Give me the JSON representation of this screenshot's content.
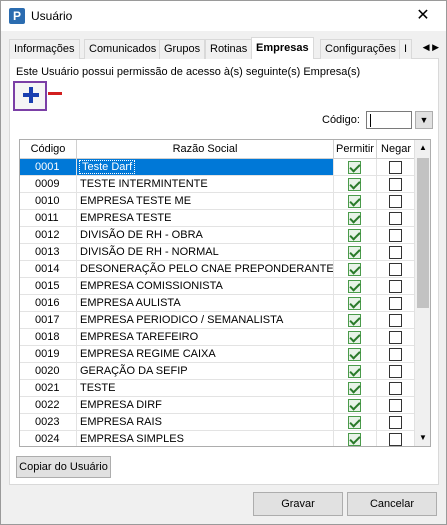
{
  "window": {
    "title": "Usuário",
    "icon_letter": "P",
    "close_glyph": "✕"
  },
  "tabs": [
    {
      "label": "Informações",
      "active": false
    },
    {
      "label": "Comunicados",
      "active": false
    },
    {
      "label": "Grupos",
      "active": false
    },
    {
      "label": "Rotinas",
      "active": false
    },
    {
      "label": "Empresas",
      "active": true
    },
    {
      "label": "Configurações",
      "active": false
    },
    {
      "label": "I",
      "active": false
    }
  ],
  "tab_scroll": {
    "left": "◀",
    "right": "▶"
  },
  "panel": {
    "info_text": "Este Usuário possui permissão de acesso à(s) seguinte(s) Empresa(s)",
    "codigo_label": "Código:",
    "codigo_value": "",
    "dropdown_glyph": "▼"
  },
  "grid": {
    "columns": [
      "Código",
      "Razão Social",
      "Permitir",
      "Negar"
    ],
    "rows": [
      {
        "codigo": "0001",
        "razao": "Teste Darf",
        "permitir": true,
        "negar": false,
        "selected": true
      },
      {
        "codigo": "0009",
        "razao": "TESTE INTERMINTENTE",
        "permitir": true,
        "negar": false
      },
      {
        "codigo": "0010",
        "razao": "EMPRESA TESTE ME",
        "permitir": true,
        "negar": false
      },
      {
        "codigo": "0011",
        "razao": "EMPRESA TESTE",
        "permitir": true,
        "negar": false
      },
      {
        "codigo": "0012",
        "razao": "DIVISÃO DE RH - OBRA",
        "permitir": true,
        "negar": false
      },
      {
        "codigo": "0013",
        "razao": "DIVISÃO DE RH - NORMAL",
        "permitir": true,
        "negar": false
      },
      {
        "codigo": "0014",
        "razao": "DESONERAÇÃO PELO CNAE PREPONDERANTE",
        "permitir": true,
        "negar": false
      },
      {
        "codigo": "0015",
        "razao": "EMPRESA COMISSIONISTA",
        "permitir": true,
        "negar": false
      },
      {
        "codigo": "0016",
        "razao": "EMPRESA AULISTA",
        "permitir": true,
        "negar": false
      },
      {
        "codigo": "0017",
        "razao": "EMPRESA PERIODICO / SEMANALISTA",
        "permitir": true,
        "negar": false
      },
      {
        "codigo": "0018",
        "razao": "EMPRESA TAREFEIRO",
        "permitir": true,
        "negar": false
      },
      {
        "codigo": "0019",
        "razao": "EMPRESA REGIME CAIXA",
        "permitir": true,
        "negar": false
      },
      {
        "codigo": "0020",
        "razao": "GERAÇÃO DA SEFIP",
        "permitir": true,
        "negar": false
      },
      {
        "codigo": "0021",
        "razao": "TESTE",
        "permitir": true,
        "negar": false
      },
      {
        "codigo": "0022",
        "razao": "EMPRESA DIRF",
        "permitir": true,
        "negar": false
      },
      {
        "codigo": "0023",
        "razao": "EMPRESA RAIS",
        "permitir": true,
        "negar": false
      },
      {
        "codigo": "0024",
        "razao": "EMPRESA SIMPLES",
        "permitir": true,
        "negar": false
      }
    ],
    "scroll_up": "▲",
    "scroll_down": "▼"
  },
  "buttons": {
    "copy": "Copiar do Usuário",
    "gravar": "Gravar",
    "cancelar": "Cancelar"
  },
  "colors": {
    "selection": "#0078d7",
    "add_icon": "#1a3fb0",
    "remove_icon": "#d21f1f",
    "highlight_border": "#7b3fa6"
  }
}
